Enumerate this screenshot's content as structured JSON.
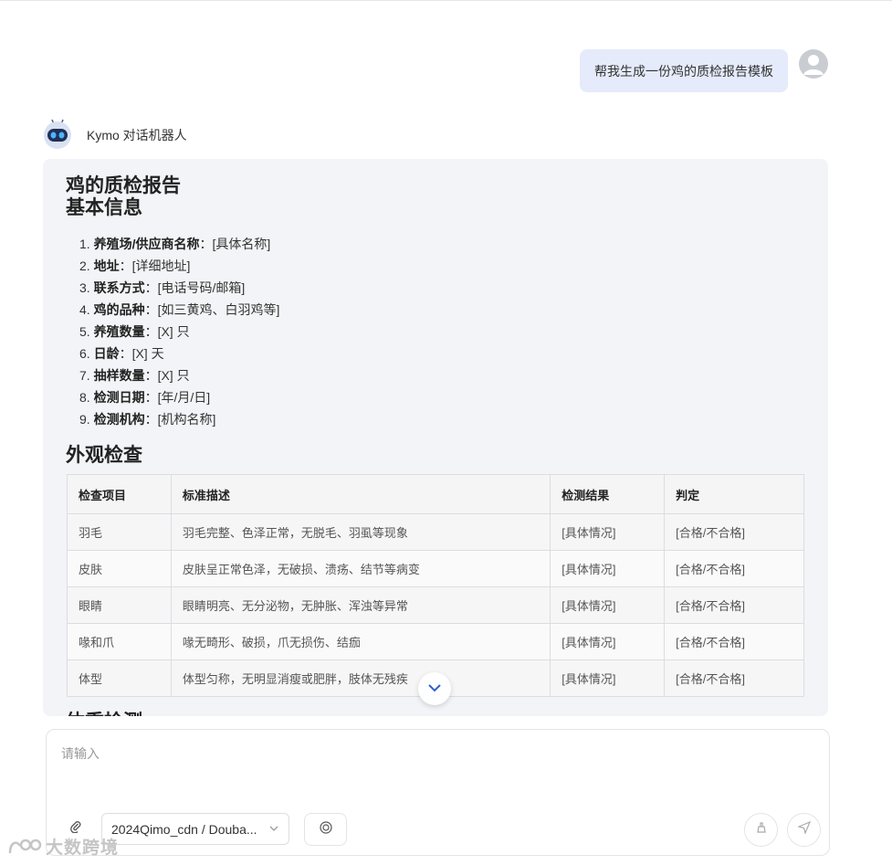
{
  "user_message": "帮我生成一份鸡的质检报告模板",
  "bot": {
    "name": "Kymo 对话机器人"
  },
  "report": {
    "title": "鸡的质检报告",
    "section_basic": "基本信息",
    "basic_info": [
      {
        "num": "1.",
        "label": "养殖场/供应商名称",
        "value": "：[具体名称]"
      },
      {
        "num": "2.",
        "label": "地址",
        "value": "：[详细地址]"
      },
      {
        "num": "3.",
        "label": "联系方式",
        "value": "：[电话号码/邮箱]"
      },
      {
        "num": "4.",
        "label": "鸡的品种",
        "value": "：[如三黄鸡、白羽鸡等]"
      },
      {
        "num": "5.",
        "label": "养殖数量",
        "value": "：[X] 只"
      },
      {
        "num": "6.",
        "label": "日龄",
        "value": "：[X] 天"
      },
      {
        "num": "7.",
        "label": "抽样数量",
        "value": "：[X] 只"
      },
      {
        "num": "8.",
        "label": "检测日期",
        "value": "：[年/月/日]"
      },
      {
        "num": "9.",
        "label": "检测机构",
        "value": "：[机构名称]"
      }
    ],
    "section_appearance": "外观检查",
    "table": {
      "headers": [
        "检查项目",
        "标准描述",
        "检测结果",
        "判定"
      ],
      "rows": [
        [
          "羽毛",
          "羽毛完整、色泽正常，无脱毛、羽虱等现象",
          "[具体情况]",
          "[合格/不合格]"
        ],
        [
          "皮肤",
          "皮肤呈正常色泽，无破损、溃疡、结节等病变",
          "[具体情况]",
          "[合格/不合格]"
        ],
        [
          "眼睛",
          "眼睛明亮、无分泌物，无肿胀、浑浊等异常",
          "[具体情况]",
          "[合格/不合格]"
        ],
        [
          "喙和爪",
          "喙无畸形、破损，爪无损伤、结痂",
          "[具体情况]",
          "[合格/不合格]"
        ],
        [
          "体型",
          "体型匀称，无明显消瘦或肥胖，肢体无残疾",
          "[具体情况]",
          "[合格/不合格]"
        ]
      ]
    },
    "section_next": "体重检测"
  },
  "input": {
    "placeholder": "请输入",
    "model": "2024Qimo_cdn / Douba..."
  },
  "watermark": "大数跨境",
  "colors": {
    "accent": "#3a6fd8",
    "user_bubble": "#e5ebfb",
    "card_bg": "#f3f4f7"
  },
  "icons": [
    "user-avatar-icon",
    "robot-icon",
    "chevron-down-icon",
    "paperclip-icon",
    "emoji-icon",
    "clear-icon",
    "send-icon"
  ]
}
